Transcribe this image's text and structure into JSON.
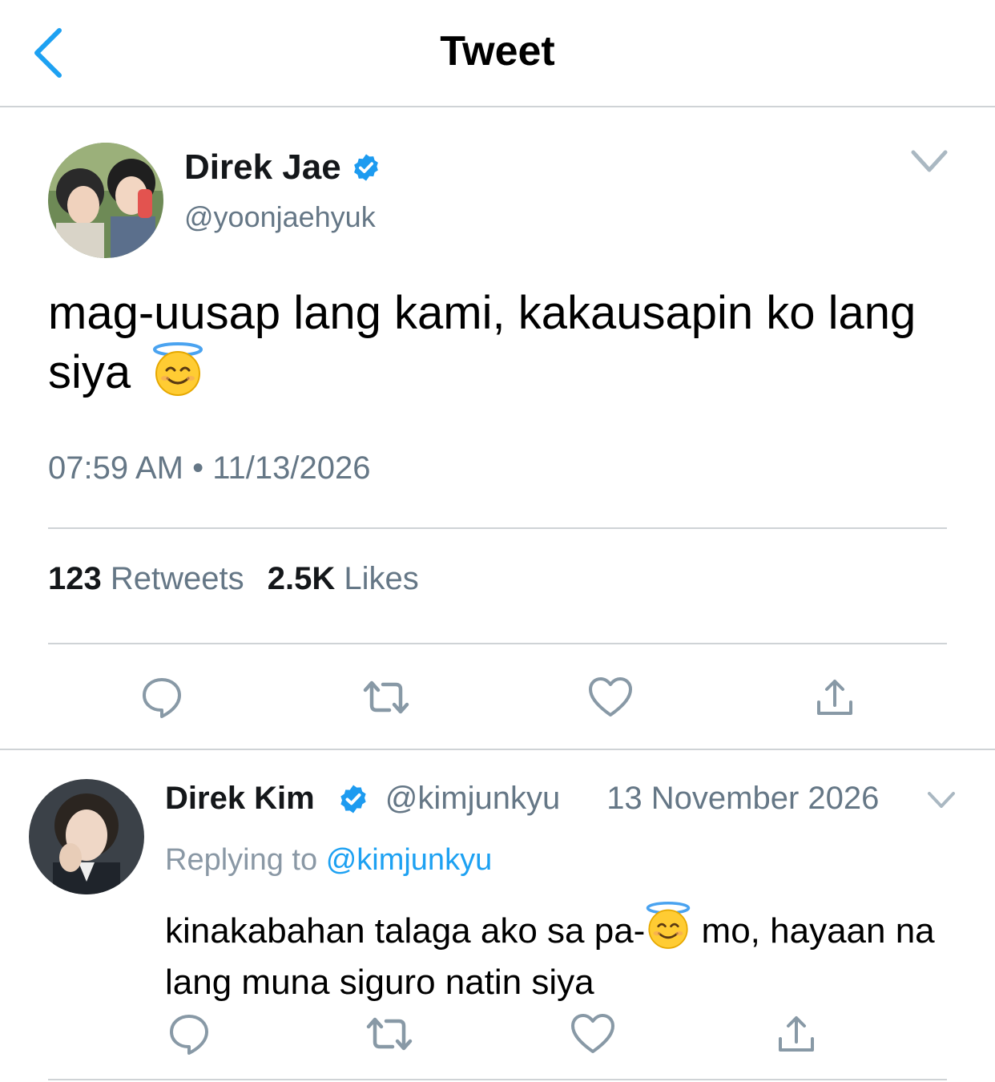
{
  "header": {
    "title": "Tweet"
  },
  "tweet": {
    "author_name": "Direk Jae",
    "author_handle": "@yoonjaehyuk",
    "text_before_emoji": "mag-uusap lang kami, kakausapin ko lang siya",
    "timestamp": "07:59 AM • 11/13/2026",
    "retweets_count": "123",
    "retweets_label": "Retweets",
    "likes_count": "2.5K",
    "likes_label": "Likes"
  },
  "reply": {
    "author_name": "Direk Kim",
    "author_handle": "@kimjunkyu",
    "date": "13 November 2026",
    "replying_prefix": "Replying to",
    "replying_to": "@kimjunkyu",
    "text_before_emoji": "kinakabahan talaga ako sa pa-",
    "text_after_emoji": " mo, hayaan na lang muna siguro natin siya"
  },
  "icons": {
    "back": "chevron-left-icon",
    "caret": "chevron-down-icon",
    "verified": "verified-badge-icon",
    "emoji": "smiling-face-with-halo-icon",
    "reply": "reply-icon",
    "retweet": "retweet-icon",
    "like": "heart-icon",
    "share": "share-icon"
  },
  "colors": {
    "accent": "#1da1f2",
    "verified": "#1d9bf0",
    "secondary_text": "#657786",
    "icon": "#8899a6",
    "divider": "#cfd3d6"
  }
}
